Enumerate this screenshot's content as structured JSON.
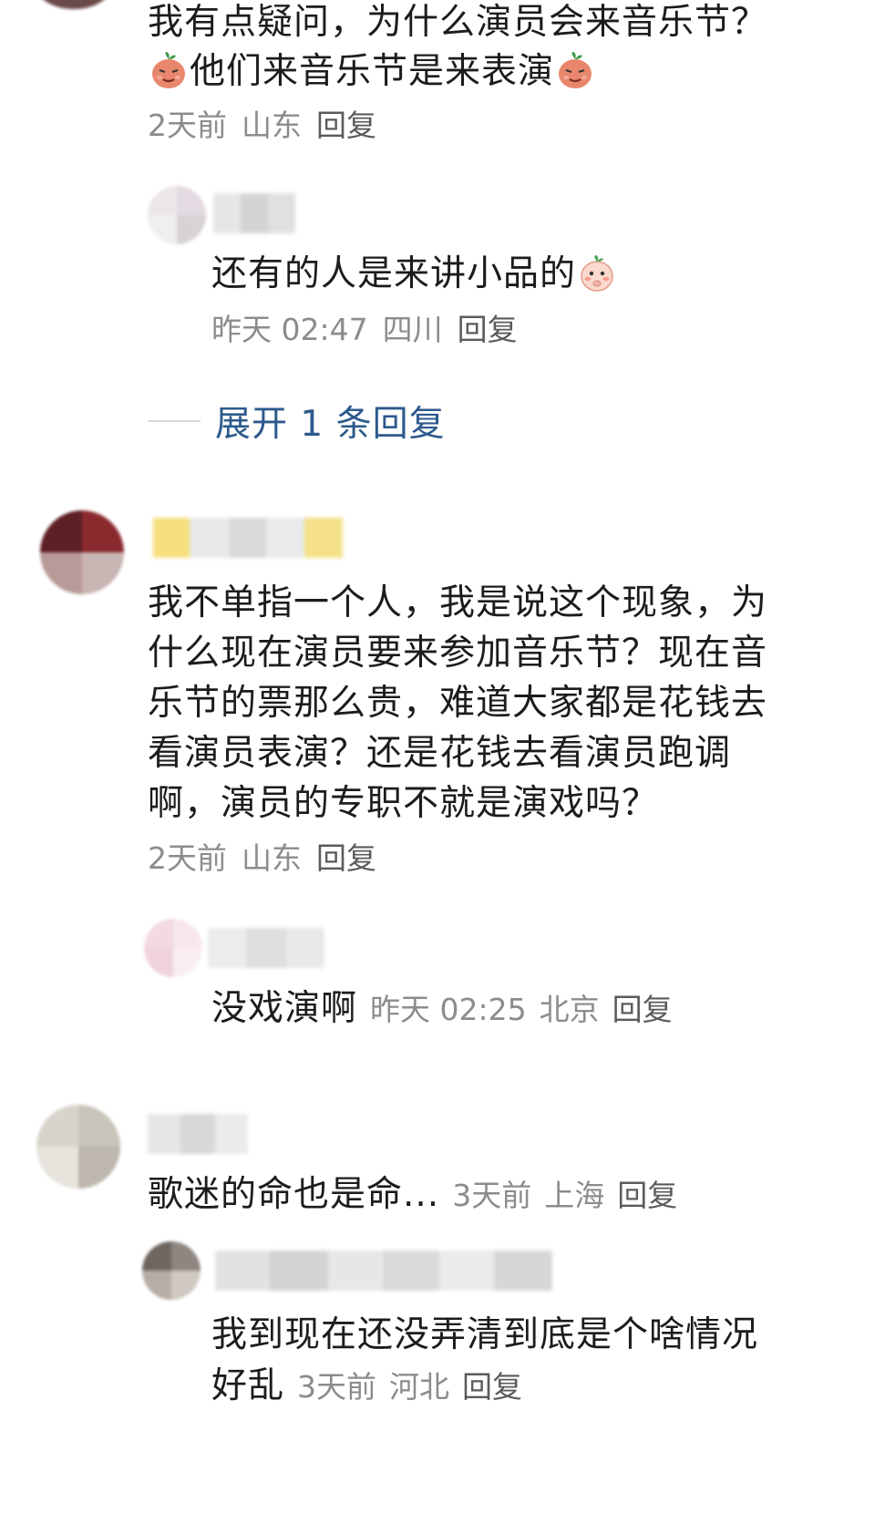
{
  "comments": [
    {
      "text": "我有点疑问，为什么演员会来音乐节？",
      "text_line2_pre": "他们来音乐节是来表演",
      "emoji": "smirk-peach-emoji",
      "meta": {
        "time": "2天前",
        "location": "山东",
        "reply": "回复"
      },
      "replies": [
        {
          "text": "还有的人是来讲小品的",
          "emoji": "shy-peach-emoji",
          "meta": {
            "time": "昨天 02:47",
            "location": "四川",
            "reply": "回复"
          }
        }
      ],
      "expand_label": "展开 1 条回复"
    },
    {
      "text": "我不单指一个人，我是说这个现象，为\n什么现在演员要来参加音乐节？现在音\n乐节的票那么贵，难道大家都是花钱去\n看演员表演？还是花钱去看演员跑调\n啊，演员的专职不就是演戏吗？",
      "meta": {
        "time": "2天前",
        "location": "山东",
        "reply": "回复"
      },
      "replies": [
        {
          "text": "没戏演啊",
          "meta": {
            "time": "昨天 02:25",
            "location": "北京",
            "reply": "回复"
          }
        }
      ]
    },
    {
      "text": "歌迷的命也是命...",
      "meta": {
        "time": "3天前",
        "location": "上海",
        "reply": "回复"
      },
      "replies": [
        {
          "text_line1": "我到现在还没弄清到底是个啥情况",
          "text_line2": "好乱",
          "meta": {
            "time": "3天前",
            "location": "河北",
            "reply": "回复"
          }
        }
      ]
    }
  ],
  "colors": {
    "text": "#1c1c1c",
    "meta": "#8c8c8c",
    "link": "#2d5a8c",
    "background": "#ffffff"
  }
}
